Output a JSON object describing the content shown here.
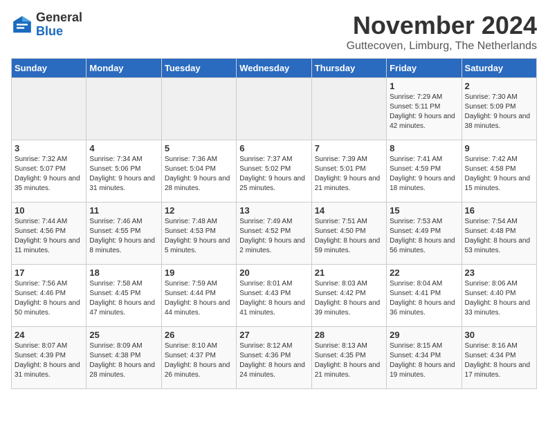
{
  "header": {
    "logo_general": "General",
    "logo_blue": "Blue",
    "title": "November 2024",
    "location": "Guttecoven, Limburg, The Netherlands"
  },
  "weekdays": [
    "Sunday",
    "Monday",
    "Tuesday",
    "Wednesday",
    "Thursday",
    "Friday",
    "Saturday"
  ],
  "weeks": [
    [
      {
        "day": "",
        "sunrise": "",
        "sunset": "",
        "daylight": "",
        "empty": true
      },
      {
        "day": "",
        "sunrise": "",
        "sunset": "",
        "daylight": "",
        "empty": true
      },
      {
        "day": "",
        "sunrise": "",
        "sunset": "",
        "daylight": "",
        "empty": true
      },
      {
        "day": "",
        "sunrise": "",
        "sunset": "",
        "daylight": "",
        "empty": true
      },
      {
        "day": "",
        "sunrise": "",
        "sunset": "",
        "daylight": "",
        "empty": true
      },
      {
        "day": "1",
        "sunrise": "Sunrise: 7:29 AM",
        "sunset": "Sunset: 5:11 PM",
        "daylight": "Daylight: 9 hours and 42 minutes.",
        "empty": false
      },
      {
        "day": "2",
        "sunrise": "Sunrise: 7:30 AM",
        "sunset": "Sunset: 5:09 PM",
        "daylight": "Daylight: 9 hours and 38 minutes.",
        "empty": false
      }
    ],
    [
      {
        "day": "3",
        "sunrise": "Sunrise: 7:32 AM",
        "sunset": "Sunset: 5:07 PM",
        "daylight": "Daylight: 9 hours and 35 minutes.",
        "empty": false
      },
      {
        "day": "4",
        "sunrise": "Sunrise: 7:34 AM",
        "sunset": "Sunset: 5:06 PM",
        "daylight": "Daylight: 9 hours and 31 minutes.",
        "empty": false
      },
      {
        "day": "5",
        "sunrise": "Sunrise: 7:36 AM",
        "sunset": "Sunset: 5:04 PM",
        "daylight": "Daylight: 9 hours and 28 minutes.",
        "empty": false
      },
      {
        "day": "6",
        "sunrise": "Sunrise: 7:37 AM",
        "sunset": "Sunset: 5:02 PM",
        "daylight": "Daylight: 9 hours and 25 minutes.",
        "empty": false
      },
      {
        "day": "7",
        "sunrise": "Sunrise: 7:39 AM",
        "sunset": "Sunset: 5:01 PM",
        "daylight": "Daylight: 9 hours and 21 minutes.",
        "empty": false
      },
      {
        "day": "8",
        "sunrise": "Sunrise: 7:41 AM",
        "sunset": "Sunset: 4:59 PM",
        "daylight": "Daylight: 9 hours and 18 minutes.",
        "empty": false
      },
      {
        "day": "9",
        "sunrise": "Sunrise: 7:42 AM",
        "sunset": "Sunset: 4:58 PM",
        "daylight": "Daylight: 9 hours and 15 minutes.",
        "empty": false
      }
    ],
    [
      {
        "day": "10",
        "sunrise": "Sunrise: 7:44 AM",
        "sunset": "Sunset: 4:56 PM",
        "daylight": "Daylight: 9 hours and 11 minutes.",
        "empty": false
      },
      {
        "day": "11",
        "sunrise": "Sunrise: 7:46 AM",
        "sunset": "Sunset: 4:55 PM",
        "daylight": "Daylight: 9 hours and 8 minutes.",
        "empty": false
      },
      {
        "day": "12",
        "sunrise": "Sunrise: 7:48 AM",
        "sunset": "Sunset: 4:53 PM",
        "daylight": "Daylight: 9 hours and 5 minutes.",
        "empty": false
      },
      {
        "day": "13",
        "sunrise": "Sunrise: 7:49 AM",
        "sunset": "Sunset: 4:52 PM",
        "daylight": "Daylight: 9 hours and 2 minutes.",
        "empty": false
      },
      {
        "day": "14",
        "sunrise": "Sunrise: 7:51 AM",
        "sunset": "Sunset: 4:50 PM",
        "daylight": "Daylight: 8 hours and 59 minutes.",
        "empty": false
      },
      {
        "day": "15",
        "sunrise": "Sunrise: 7:53 AM",
        "sunset": "Sunset: 4:49 PM",
        "daylight": "Daylight: 8 hours and 56 minutes.",
        "empty": false
      },
      {
        "day": "16",
        "sunrise": "Sunrise: 7:54 AM",
        "sunset": "Sunset: 4:48 PM",
        "daylight": "Daylight: 8 hours and 53 minutes.",
        "empty": false
      }
    ],
    [
      {
        "day": "17",
        "sunrise": "Sunrise: 7:56 AM",
        "sunset": "Sunset: 4:46 PM",
        "daylight": "Daylight: 8 hours and 50 minutes.",
        "empty": false
      },
      {
        "day": "18",
        "sunrise": "Sunrise: 7:58 AM",
        "sunset": "Sunset: 4:45 PM",
        "daylight": "Daylight: 8 hours and 47 minutes.",
        "empty": false
      },
      {
        "day": "19",
        "sunrise": "Sunrise: 7:59 AM",
        "sunset": "Sunset: 4:44 PM",
        "daylight": "Daylight: 8 hours and 44 minutes.",
        "empty": false
      },
      {
        "day": "20",
        "sunrise": "Sunrise: 8:01 AM",
        "sunset": "Sunset: 4:43 PM",
        "daylight": "Daylight: 8 hours and 41 minutes.",
        "empty": false
      },
      {
        "day": "21",
        "sunrise": "Sunrise: 8:03 AM",
        "sunset": "Sunset: 4:42 PM",
        "daylight": "Daylight: 8 hours and 39 minutes.",
        "empty": false
      },
      {
        "day": "22",
        "sunrise": "Sunrise: 8:04 AM",
        "sunset": "Sunset: 4:41 PM",
        "daylight": "Daylight: 8 hours and 36 minutes.",
        "empty": false
      },
      {
        "day": "23",
        "sunrise": "Sunrise: 8:06 AM",
        "sunset": "Sunset: 4:40 PM",
        "daylight": "Daylight: 8 hours and 33 minutes.",
        "empty": false
      }
    ],
    [
      {
        "day": "24",
        "sunrise": "Sunrise: 8:07 AM",
        "sunset": "Sunset: 4:39 PM",
        "daylight": "Daylight: 8 hours and 31 minutes.",
        "empty": false
      },
      {
        "day": "25",
        "sunrise": "Sunrise: 8:09 AM",
        "sunset": "Sunset: 4:38 PM",
        "daylight": "Daylight: 8 hours and 28 minutes.",
        "empty": false
      },
      {
        "day": "26",
        "sunrise": "Sunrise: 8:10 AM",
        "sunset": "Sunset: 4:37 PM",
        "daylight": "Daylight: 8 hours and 26 minutes.",
        "empty": false
      },
      {
        "day": "27",
        "sunrise": "Sunrise: 8:12 AM",
        "sunset": "Sunset: 4:36 PM",
        "daylight": "Daylight: 8 hours and 24 minutes.",
        "empty": false
      },
      {
        "day": "28",
        "sunrise": "Sunrise: 8:13 AM",
        "sunset": "Sunset: 4:35 PM",
        "daylight": "Daylight: 8 hours and 21 minutes.",
        "empty": false
      },
      {
        "day": "29",
        "sunrise": "Sunrise: 8:15 AM",
        "sunset": "Sunset: 4:34 PM",
        "daylight": "Daylight: 8 hours and 19 minutes.",
        "empty": false
      },
      {
        "day": "30",
        "sunrise": "Sunrise: 8:16 AM",
        "sunset": "Sunset: 4:34 PM",
        "daylight": "Daylight: 8 hours and 17 minutes.",
        "empty": false
      }
    ]
  ]
}
